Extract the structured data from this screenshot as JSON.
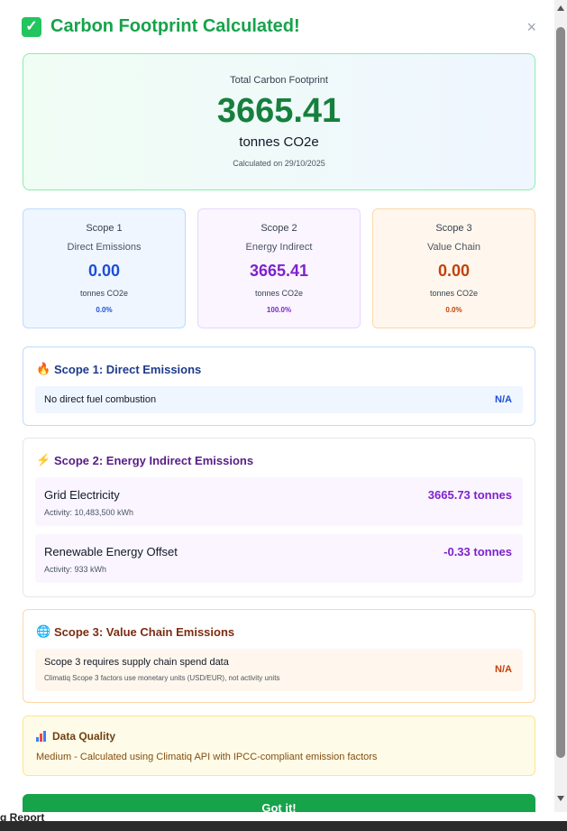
{
  "modal": {
    "title": "Carbon Footprint Calculated!",
    "close_glyph": "×",
    "icons": {
      "title": "check-icon",
      "close": "close-icon"
    }
  },
  "total": {
    "label": "Total Carbon Footprint",
    "value": "3665.41",
    "unit": "tonnes CO2e",
    "date": "Calculated on 29/10/2025"
  },
  "scopes": [
    {
      "name": "Scope 1",
      "subtitle": "Direct Emissions",
      "value": "0.00",
      "unit": "tonnes CO2e",
      "percent": "0.0%",
      "color": "#1d4ed8"
    },
    {
      "name": "Scope 2",
      "subtitle": "Energy Indirect",
      "value": "3665.41",
      "unit": "tonnes CO2e",
      "percent": "100.0%",
      "color": "#7e22ce"
    },
    {
      "name": "Scope 3",
      "subtitle": "Value Chain",
      "value": "0.00",
      "unit": "tonnes CO2e",
      "percent": "0.0%",
      "color": "#c2410c"
    }
  ],
  "scope1_detail": {
    "icon": "fire-icon",
    "title": "Scope 1: Direct Emissions",
    "rows": [
      {
        "label": "No direct fuel combustion",
        "value": "N/A"
      }
    ]
  },
  "scope2_detail": {
    "icon": "lightning-icon",
    "title": "Scope 2: Energy Indirect Emissions",
    "rows": [
      {
        "label": "Grid Electricity",
        "activity": "Activity: 10,483,500 kWh",
        "value": "3665.73 tonnes"
      },
      {
        "label": "Renewable Energy Offset",
        "activity": "Activity: 933 kWh",
        "value": "-0.33 tonnes"
      }
    ]
  },
  "scope3_detail": {
    "icon": "globe-icon",
    "title": "Scope 3: Value Chain Emissions",
    "rows": [
      {
        "label": "Scope 3 requires supply chain spend data",
        "note": "Climatiq Scope 3 factors use monetary units (USD/EUR), not activity units",
        "value": "N/A"
      }
    ]
  },
  "data_quality": {
    "icon": "bar-chart-icon",
    "title": "Data Quality",
    "text": "Medium - Calculated using Climatiq API with IPCC-compliant emission factors"
  },
  "footer": {
    "button_label": "Got it!"
  },
  "background": {
    "partial_text": "g Report"
  },
  "colors": {
    "success": "#16a34a",
    "scope1": "#1d4ed8",
    "scope2": "#7e22ce",
    "scope3": "#c2410c"
  }
}
